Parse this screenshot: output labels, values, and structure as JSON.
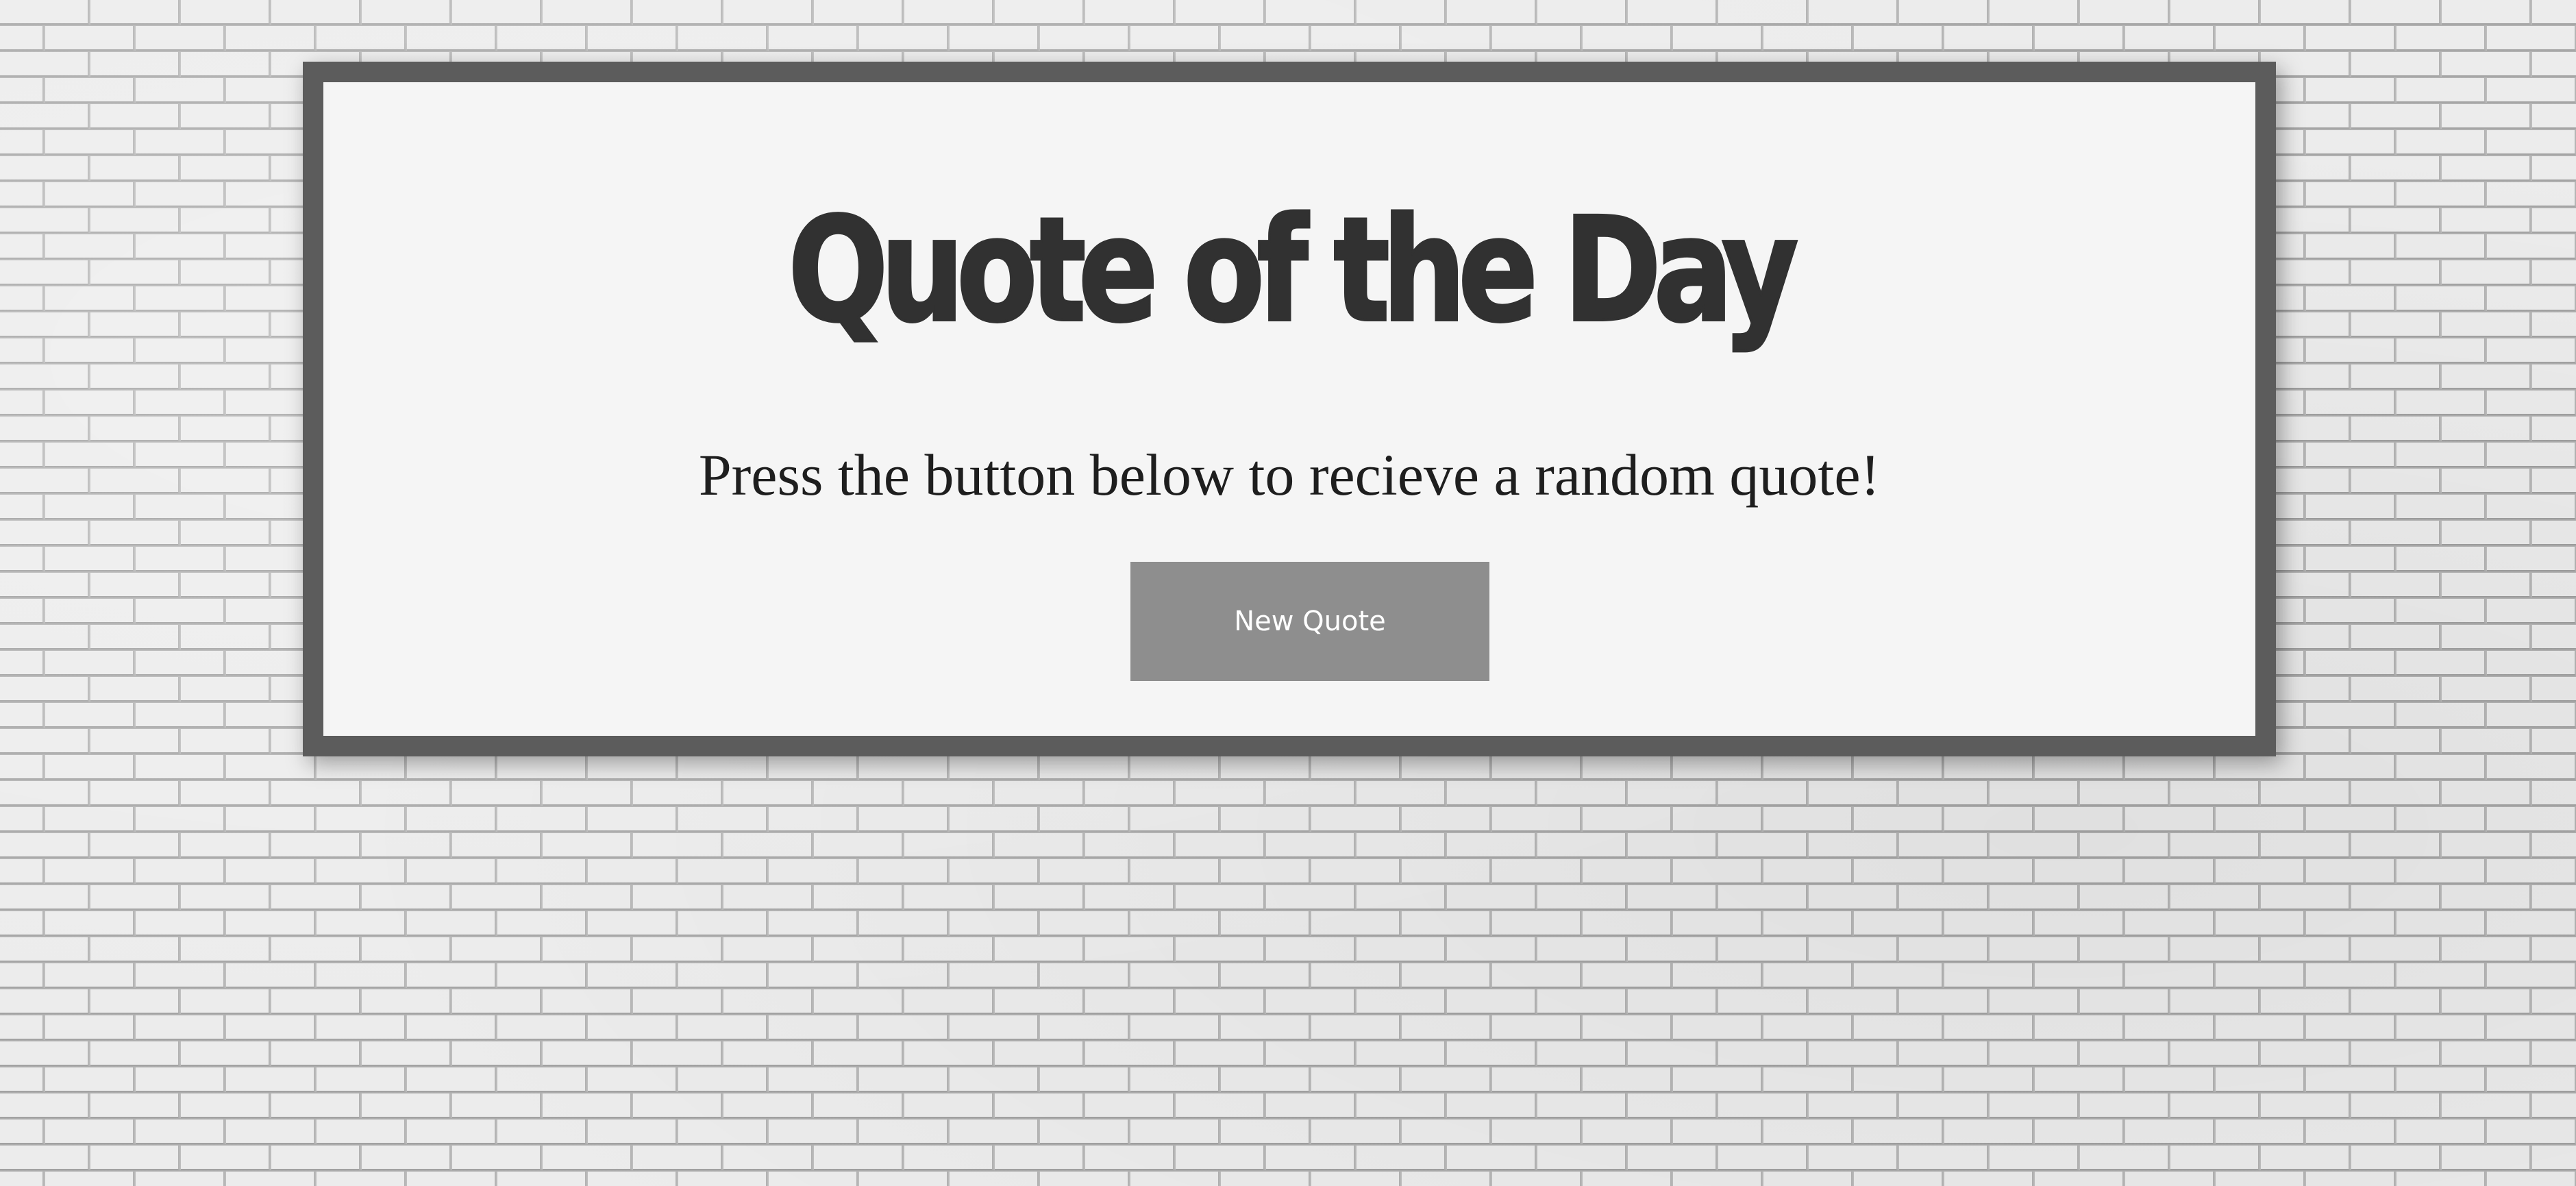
{
  "page": {
    "background": "brick-wall-white",
    "frame_color": "#5c5c5c",
    "card_color": "#f5f5f5"
  },
  "quote_box": {
    "title": "Quote of the Day",
    "prompt": "Press the button below to recieve a random quote!",
    "button_label": "New Quote",
    "button_color": "#8e8e8e"
  }
}
